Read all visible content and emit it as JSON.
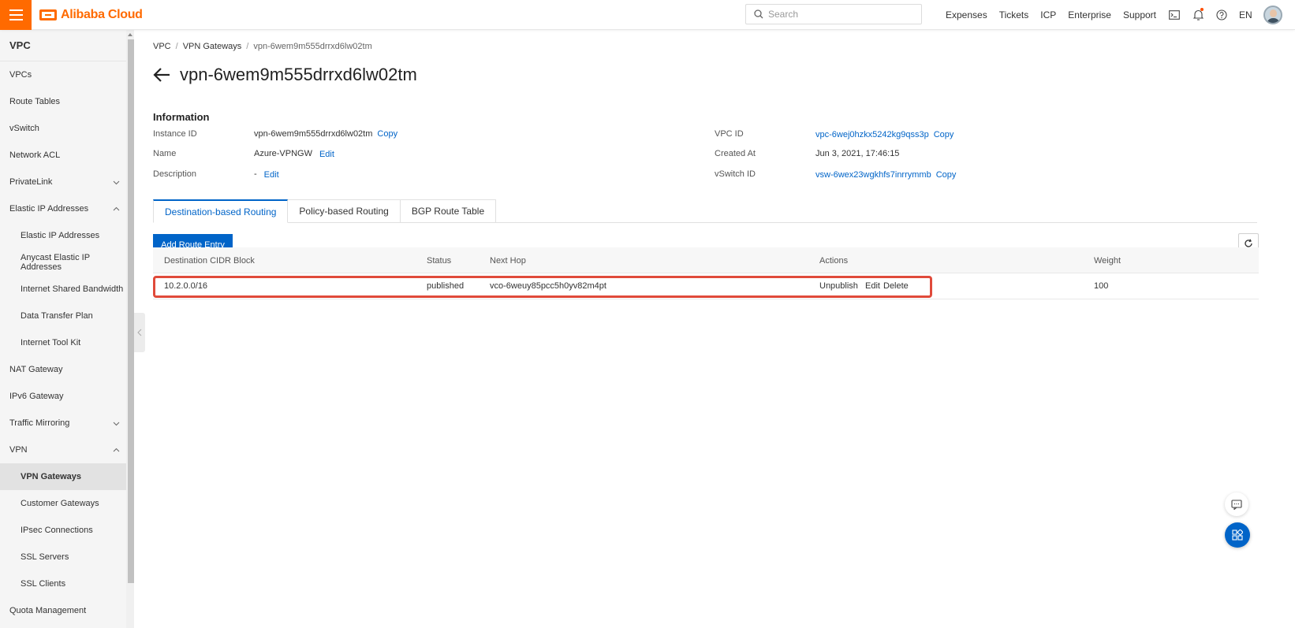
{
  "topbar": {
    "logo_text": "Alibaba Cloud",
    "search_placeholder": "Search",
    "nav": [
      "Expenses",
      "Tickets",
      "ICP",
      "Enterprise",
      "Support"
    ],
    "language": "EN",
    "accent_color": "#ff6a00"
  },
  "sidebar": {
    "title": "VPC",
    "items": [
      {
        "label": "VPCs"
      },
      {
        "label": "Route Tables"
      },
      {
        "label": "vSwitch"
      },
      {
        "label": "Network ACL"
      },
      {
        "label": "PrivateLink"
      },
      {
        "label": "Elastic IP Addresses"
      },
      {
        "label": "Elastic IP Addresses"
      },
      {
        "label": "Anycast Elastic IP Addresses"
      },
      {
        "label": "Internet Shared Bandwidth"
      },
      {
        "label": "Data Transfer Plan"
      },
      {
        "label": "Internet Tool Kit"
      },
      {
        "label": "NAT Gateway"
      },
      {
        "label": "IPv6 Gateway"
      },
      {
        "label": "Traffic Mirroring"
      },
      {
        "label": "VPN"
      },
      {
        "label": "VPN Gateways"
      },
      {
        "label": "Customer Gateways"
      },
      {
        "label": "IPsec Connections"
      },
      {
        "label": "SSL Servers"
      },
      {
        "label": "SSL Clients"
      },
      {
        "label": "Quota Management"
      }
    ]
  },
  "breadcrumb": [
    "VPC",
    "VPN Gateways",
    "vpn-6wem9m555drrxd6lw02tm"
  ],
  "page": {
    "title": "vpn-6wem9m555drrxd6lw02tm",
    "section_title": "Information"
  },
  "info": {
    "instance_id_label": "Instance ID",
    "instance_id": "vpn-6wem9m555drrxd6lw02tm",
    "name_label": "Name",
    "name": "Azure-VPNGW",
    "description_label": "Description",
    "description": "-",
    "vpc_id_label": "VPC ID",
    "vpc_id": "vpc-6wej0hzkx5242kg9qss3p",
    "created_at_label": "Created At",
    "created_at": "Jun 3, 2021, 17:46:15",
    "vswitch_id_label": "vSwitch ID",
    "vswitch_id": "vsw-6wex23wgkhfs7inrrymmb",
    "copy_label": "Copy",
    "edit_label": "Edit"
  },
  "tabs": [
    "Destination-based Routing",
    "Policy-based Routing",
    "BGP Route Table"
  ],
  "add_button": "Add Route Entry",
  "table": {
    "headers": [
      "Destination CIDR Block",
      "Status",
      "Next Hop",
      "Actions",
      "Weight"
    ],
    "rows": [
      {
        "cidr": "10.2.0.0/16",
        "status": "published",
        "next_hop": "vco-6weuy85pcc5h0yv82m4pt",
        "actions": [
          "Unpublish",
          "Edit",
          "Delete"
        ],
        "weight": "100"
      }
    ]
  },
  "colors": {
    "primary": "#0064c8",
    "highlight_border": "#e04a3a"
  }
}
